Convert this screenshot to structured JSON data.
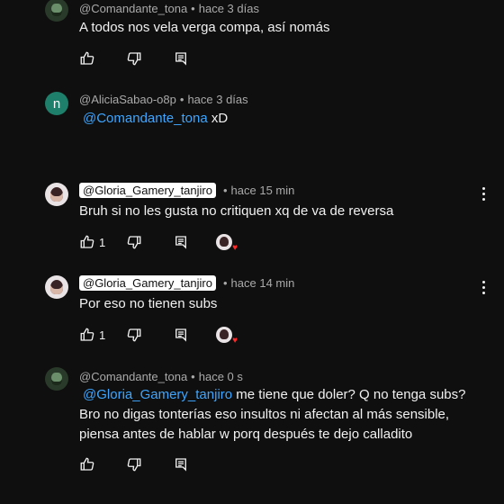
{
  "comments": [
    {
      "author": "@Comandante_tona",
      "time": "hace 3 días",
      "text": "A todos nos vela verga compa, así nomás",
      "likes": ""
    },
    {
      "author": "@AliciaSabao-o8p",
      "time": "hace 3 días",
      "avatar_letter": "n",
      "mention": "@Comandante_tona",
      "text": "xD",
      "likes": ""
    },
    {
      "author": "@Gloria_Gamery_tanjiro",
      "time": "hace 15 min",
      "text": "Bruh si no les gusta no critiquen xq de va de reversa",
      "likes": "1"
    },
    {
      "author": "@Gloria_Gamery_tanjiro",
      "time": "hace 14 min",
      "text": "Por eso no tienen subs",
      "likes": "1"
    },
    {
      "author": "@Comandante_tona",
      "time": "hace 0 s",
      "mention": "@Gloria_Gamery_tanjiro",
      "text": "me tiene que doler? Q no tenga subs? Bro no digas tonterías eso insultos ni afectan al más sensible, piensa antes de hablar w porq después te dejo calladito",
      "likes": ""
    }
  ],
  "separator": "•",
  "icons": {
    "like": "thumbs-up-icon",
    "dislike": "thumbs-down-icon",
    "reply": "reply-icon",
    "more": "more-vert-icon",
    "heart": "heart-icon"
  },
  "colors": {
    "background": "#0f0f0f",
    "mention": "#3ea6ff",
    "heart": "#ff2b2b"
  }
}
